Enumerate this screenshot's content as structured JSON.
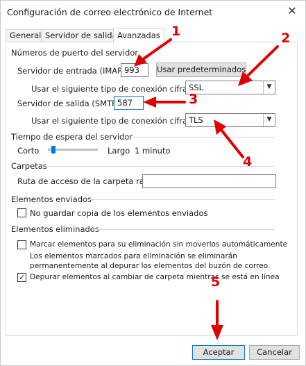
{
  "window": {
    "title": "Configuración de correo electrónico de Internet",
    "close_glyph": "✕"
  },
  "tabs": [
    {
      "label": "General",
      "active": false
    },
    {
      "label": "Servidor de salida",
      "active": false
    },
    {
      "label": "Avanzadas",
      "active": true
    }
  ],
  "ports": {
    "heading": "Números de puerto del servidor",
    "incoming_label": "Servidor de entrada (IMAP):",
    "incoming_value": "993",
    "defaults_button": "Usar predeterminados",
    "incoming_encryption_label": "Usar el siguiente tipo de conexión cifrada:",
    "incoming_encryption_value": "SSL",
    "outgoing_label": "Servidor de salida (SMTP):",
    "outgoing_value": "587",
    "outgoing_encryption_label": "Usar el siguiente tipo de conexión cifrada:",
    "outgoing_encryption_value": "TLS"
  },
  "timeout": {
    "heading": "Tiempo de espera del servidor",
    "short_label": "Corto",
    "long_label": "Largo",
    "value_text": "1 minuto",
    "slider_level": 0.08
  },
  "folders": {
    "heading": "Carpetas",
    "root_label": "Ruta de acceso de la carpeta raíz:",
    "root_value": ""
  },
  "sent": {
    "heading": "Elementos enviados",
    "no_copy_label": "No guardar copia de los elementos enviados",
    "no_copy_checked": false
  },
  "deleted": {
    "heading": "Elementos eliminados",
    "mark_label": "Marcar elementos para su eliminación sin moverlos automáticamente",
    "mark_checked": false,
    "note_line1": "Los elementos marcados para eliminación se eliminarán",
    "note_line2": "permanentemente al depurar los elementos del buzón de correo.",
    "purge_label": "Depurar elementos al cambiar de carpeta mientras se está en línea",
    "purge_checked": true,
    "check_glyph": "✓"
  },
  "footer": {
    "accept_label": "Aceptar",
    "cancel_label": "Cancelar"
  },
  "annotations": {
    "color": "#e00000",
    "numbers": [
      "1",
      "2",
      "3",
      "4",
      "5"
    ]
  }
}
